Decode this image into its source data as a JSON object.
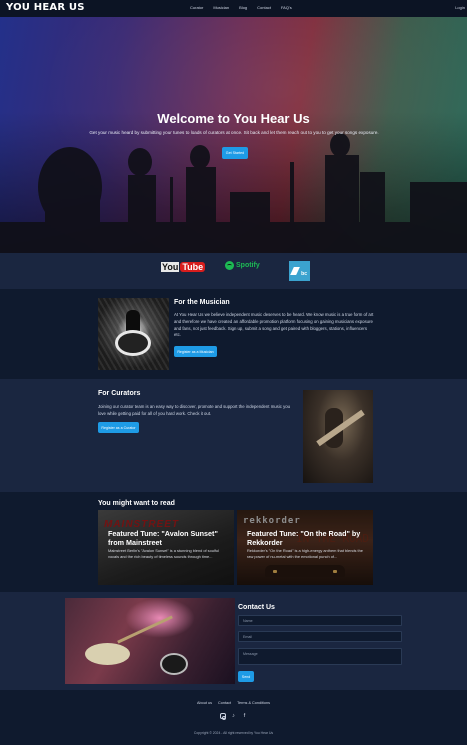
{
  "nav": {
    "logo": "YOU HEAR US",
    "links": [
      "Curator",
      "Musician",
      "Blog",
      "Contact",
      "FAQ's"
    ],
    "login": "Login"
  },
  "hero": {
    "title": "Welcome to You Hear Us",
    "subtitle": "Get your music heard by submitting your tunes to loads of curators at once. Sit back and let them reach out to you to get your songs exposure.",
    "cta": "Get Started"
  },
  "logos": {
    "youtube_you": "You",
    "youtube_tube": "Tube",
    "spotify": "Spotify",
    "bandcamp": "bc",
    "icons": [
      "youtube-logo",
      "spotify-logo",
      "bandcamp-logo"
    ]
  },
  "musician": {
    "heading": "For the Musician",
    "body": "At You Hear Us we believe independent music deserves to be heard. We know music is a true form of art and therefore we have created an affordable promotion platform focusing on gaining musicians exposure and fans, not just feedback. Sign up, submit a song and get paired with bloggers, stations, influencers etc.",
    "button": "Register as a Musician"
  },
  "curators": {
    "heading": "For Curators",
    "body": "Joining our curator team is an easy way to discover, promote and support the independent music you love while getting paid for all of you hard work. Check it out.",
    "button": "Register as a Curator"
  },
  "read": {
    "heading": "You might want to read",
    "cards": [
      {
        "brand": "MAINSTREET",
        "title": "Featured Tune: \"Avalon Sunset\" from Mainstreet",
        "desc": "Mainstreet Berlin's \"Avalon Sunset\" is a stunning blend of soulful vocals and the rich beauty of timeless sounds through time..."
      },
      {
        "brand": "rekkorder",
        "brand2": "IN THE ROAD",
        "title": "Featured Tune: \"On the Road\" by Rekkorder",
        "desc": "Rekkorder's \"On the Road\" is a high-energy anthem that blends the raw power of nu-metal with the emotional punch of..."
      }
    ]
  },
  "contact": {
    "heading": "Contact Us",
    "name_placeholder": "Name",
    "email_placeholder": "Email",
    "message_placeholder": "Message",
    "send": "Send"
  },
  "footer": {
    "links": [
      "About us",
      "Contact",
      "Terms & Conditions"
    ],
    "socials": [
      "instagram-icon",
      "tiktok-icon",
      "facebook-icon"
    ],
    "tiktok_glyph": "♪",
    "facebook_glyph": "f",
    "copyright": "Copyright © 2024 - All right reserved by You Hear Us"
  }
}
